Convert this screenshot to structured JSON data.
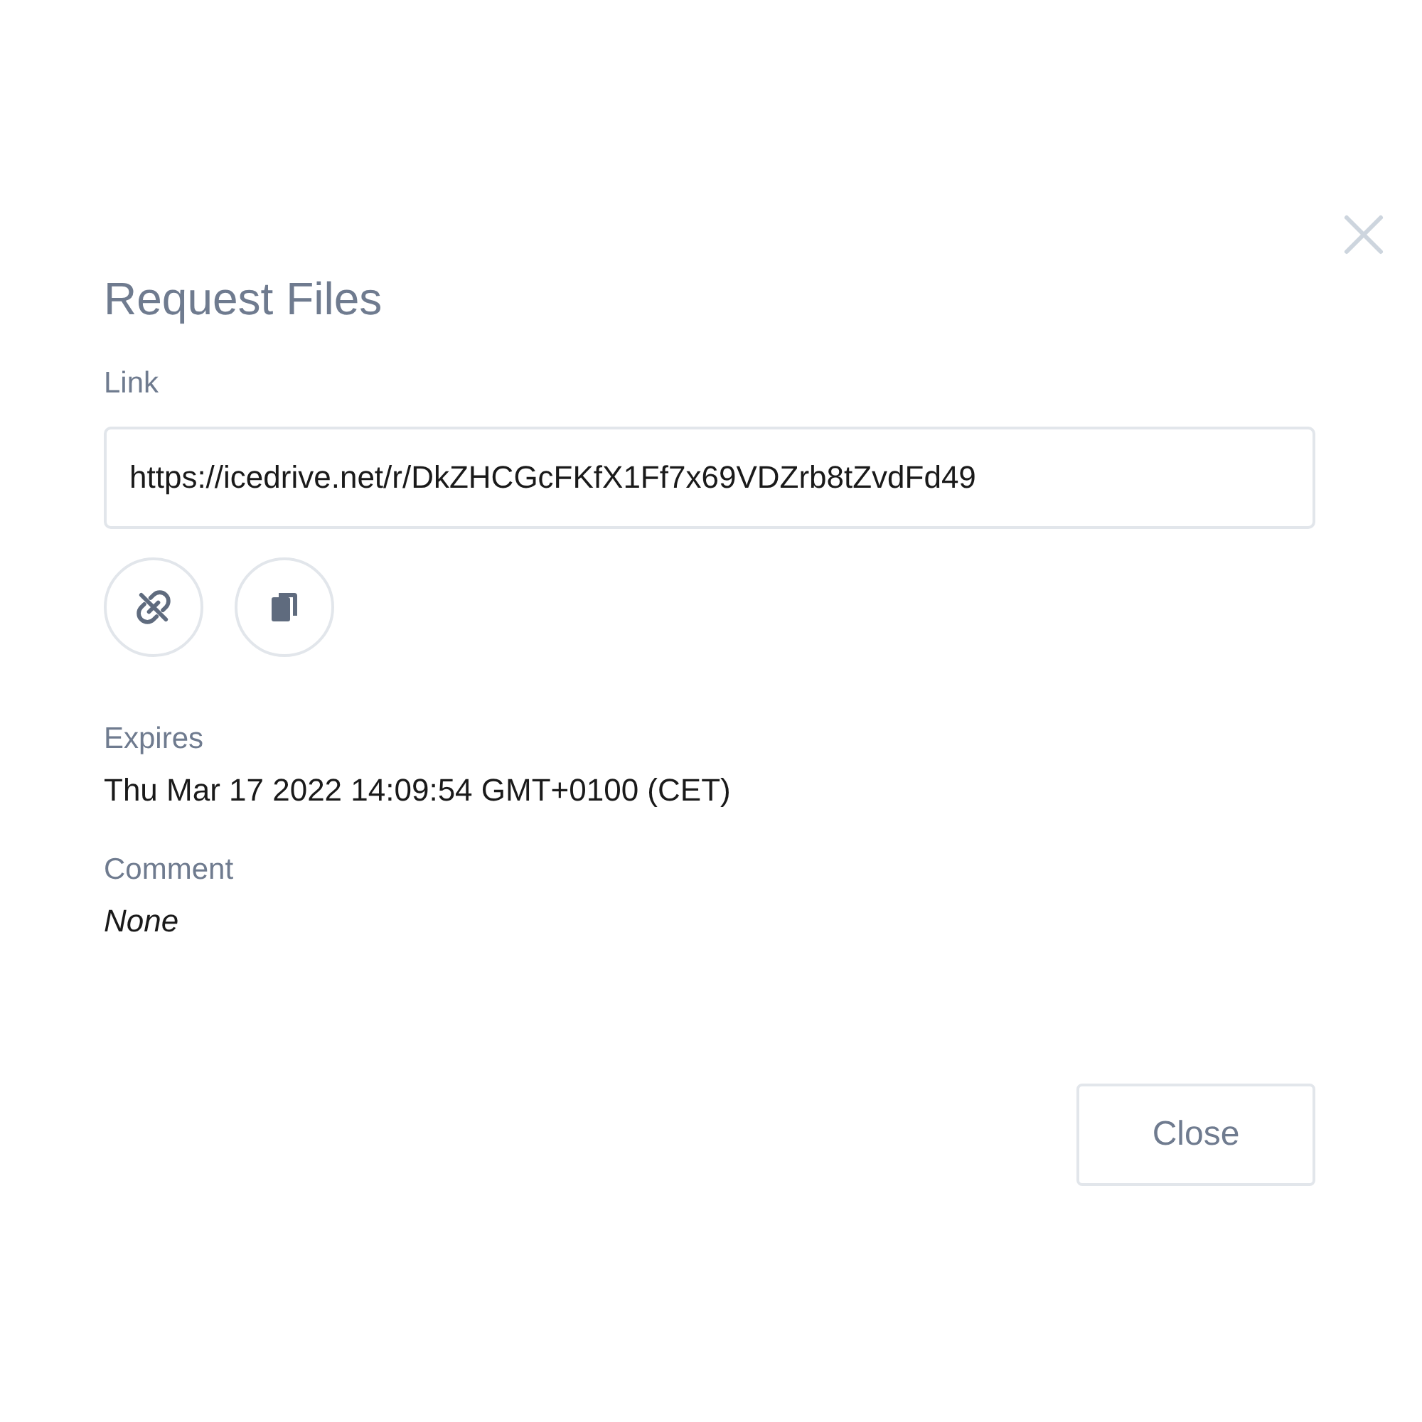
{
  "dialog": {
    "title": "Request Files",
    "link": {
      "label": "Link",
      "value": "https://icedrive.net/r/DkZHCGcFKfX1Ff7x69VDZrb8tZvdFd49"
    },
    "actions": [
      {
        "kind": "unlink"
      },
      {
        "kind": "copy"
      }
    ],
    "expires": {
      "label": "Expires",
      "value": "Thu Mar 17 2022 14:09:54 GMT+0100 (CET)"
    },
    "comment": {
      "label": "Comment",
      "value": "None"
    },
    "buttons": [
      "Close"
    ]
  }
}
